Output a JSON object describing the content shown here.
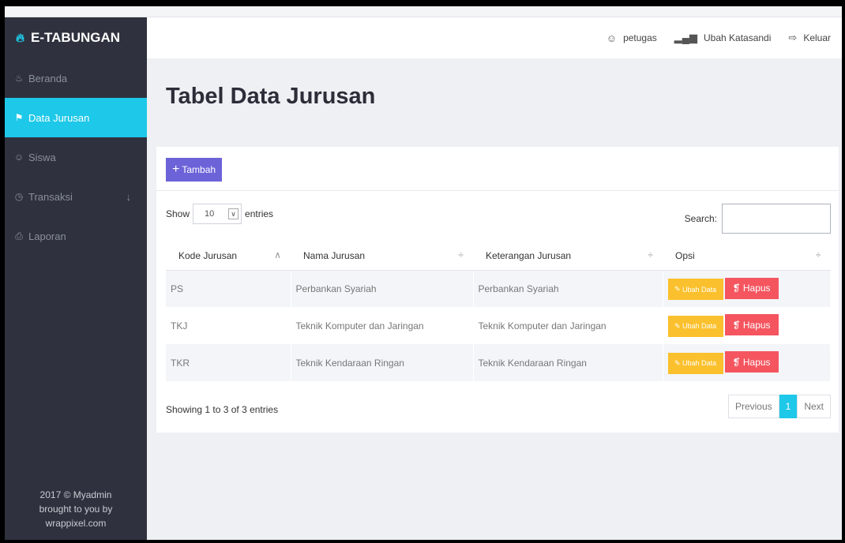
{
  "sidebar": {
    "brand": "E-TABUNGAN",
    "items": [
      {
        "label": "Beranda",
        "icon": "flame-icon"
      },
      {
        "label": "Data Jurusan",
        "icon": "signpost-icon"
      },
      {
        "label": "Siswa",
        "icon": "user-icon"
      },
      {
        "label": "Transaksi",
        "icon": "clock-icon"
      },
      {
        "label": "Laporan",
        "icon": "print-icon"
      }
    ],
    "footer": [
      "2017 © Myadmin",
      "brought to you by",
      "wrappixel.com"
    ]
  },
  "header": {
    "user": "petugas",
    "change_password": "Ubah Katasandi",
    "logout": "Keluar"
  },
  "page": {
    "title": "Tabel Data Jurusan"
  },
  "card": {
    "add_label": "Tambah"
  },
  "controls": {
    "show_label": "Show",
    "entries_value": "10",
    "entries_label": "entries",
    "search_label": "Search:"
  },
  "table": {
    "headers": [
      "Kode Jurusan",
      "Nama Jurusan",
      "Keterangan Jurusan",
      "Opsi"
    ],
    "rows": [
      {
        "kode": "PS",
        "nama": "Perbankan Syariah",
        "keterangan": "Perbankan Syariah"
      },
      {
        "kode": "TKJ",
        "nama": "Teknik Komputer dan Jaringan",
        "keterangan": "Teknik Komputer dan Jaringan"
      },
      {
        "kode": "TKR",
        "nama": "Teknik Kendaraan Ringan",
        "keterangan": "Teknik Kendaraan Ringan"
      }
    ],
    "edit_label": "Ubah Data",
    "delete_label": "Hapus"
  },
  "footer": {
    "info": "Showing 1 to 3 of 3 entries",
    "previous": "Previous",
    "page": "1",
    "next": "Next"
  },
  "colors": {
    "accent": "#1ec8e8",
    "sidebar": "#2f323e",
    "add": "#6c63d8",
    "edit": "#fbc02d",
    "delete": "#f5555f"
  }
}
